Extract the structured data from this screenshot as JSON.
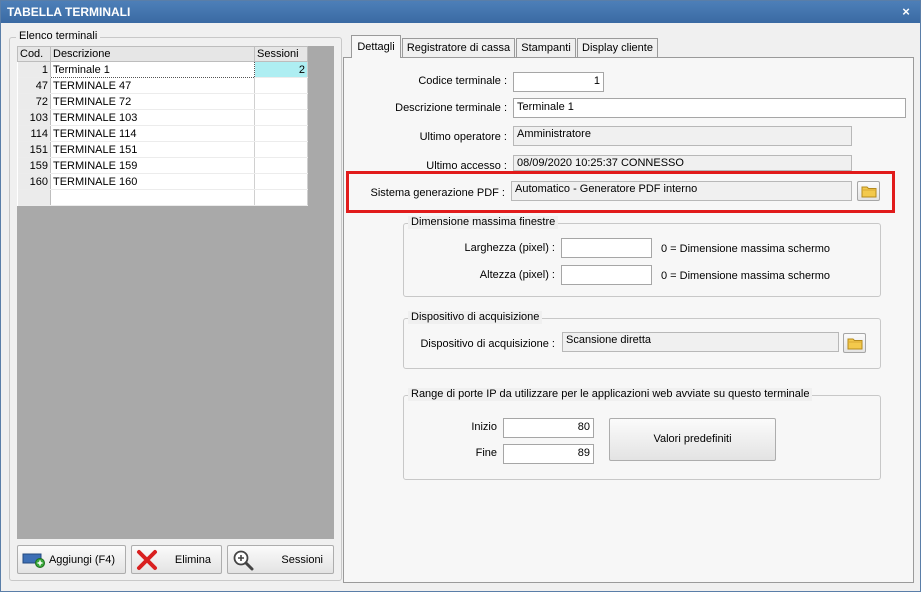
{
  "window": {
    "title": "TABELLA TERMINALI",
    "close_glyph": "×"
  },
  "list": {
    "group_title": "Elenco terminali",
    "columns": [
      "Cod.",
      "Descrizione",
      "Sessioni"
    ],
    "rows": [
      {
        "code": "1",
        "desc": "Terminale 1",
        "sess": "2"
      },
      {
        "code": "47",
        "desc": "TERMINALE 47",
        "sess": ""
      },
      {
        "code": "72",
        "desc": "TERMINALE 72",
        "sess": ""
      },
      {
        "code": "103",
        "desc": "TERMINALE 103",
        "sess": ""
      },
      {
        "code": "114",
        "desc": "TERMINALE 114",
        "sess": ""
      },
      {
        "code": "151",
        "desc": "TERMINALE 151",
        "sess": ""
      },
      {
        "code": "159",
        "desc": "TERMINALE 159",
        "sess": ""
      },
      {
        "code": "160",
        "desc": "TERMINALE 160",
        "sess": ""
      }
    ]
  },
  "buttons": {
    "add": "Aggiungi (F4)",
    "delete": "Elimina",
    "sessions": "Sessioni"
  },
  "tabs": [
    "Dettagli",
    "Registratore di cassa",
    "Stampanti",
    "Display cliente"
  ],
  "details": {
    "code_label": "Codice terminale :",
    "code_value": "1",
    "desc_label": "Descrizione terminale :",
    "desc_value": "Terminale 1",
    "operator_label": "Ultimo operatore :",
    "operator_value": "Amministratore",
    "access_label": "Ultimo accesso :",
    "access_value": "08/09/2020  10:25:37  CONNESSO",
    "pdf_label": "Sistema generazione PDF :",
    "pdf_value": "Automatico - Generatore PDF interno"
  },
  "window_size": {
    "group_title": "Dimensione massima finestre",
    "width_label": "Larghezza (pixel) :",
    "width_value": "",
    "width_hint": "0 = Dimensione massima schermo",
    "height_label": "Altezza (pixel) :",
    "height_value": "",
    "height_hint": "0 = Dimensione massima schermo"
  },
  "acquisition": {
    "group_title": "Dispositivo di acquisizione",
    "label": "Dispositivo di acquisizione :",
    "value": "Scansione diretta"
  },
  "ports": {
    "group_title": "Range di porte IP da utilizzare per le applicazioni web avviate su questo terminale",
    "start_label": "Inizio",
    "start_value": "80",
    "end_label": "Fine",
    "end_value": "89",
    "defaults_button": "Valori predefiniti"
  },
  "colors": {
    "title_bar": "#3a6aa3",
    "selection": "#aeeef2",
    "highlight": "#e11b1b"
  }
}
